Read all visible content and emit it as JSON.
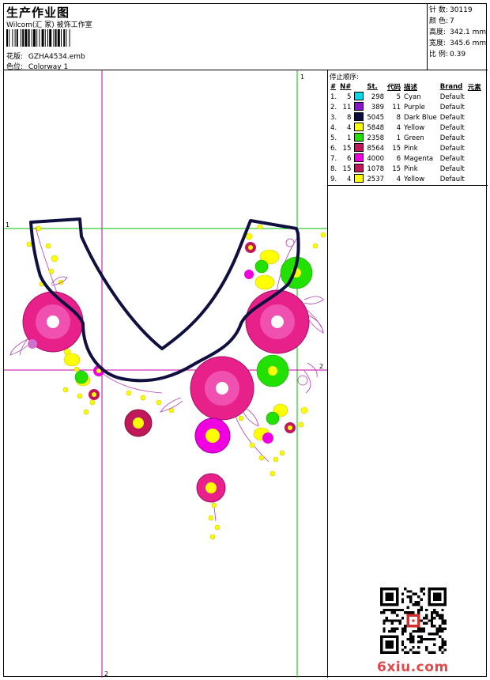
{
  "header": {
    "title": "生产作业图",
    "subtitle": "Wilcom(汇 冢) 被饰工作室",
    "design_label": "花版:",
    "design_value": "GZHA4534.emb",
    "colorway_label": "色位:",
    "colorway_value": "Colorway 1"
  },
  "stats": [
    {
      "label": "针 数:",
      "value": "30119"
    },
    {
      "label": "颜 色:",
      "value": "7"
    },
    {
      "label": "高度:",
      "value": "342.1 mm"
    },
    {
      "label": "宽度:",
      "value": "345.6 mm"
    },
    {
      "label": "比 例:",
      "value": "0.39"
    }
  ],
  "stop_sequence": {
    "title": "停止顺序:",
    "columns": [
      "#",
      "N#",
      "St.",
      "代码",
      "描述",
      "Brand",
      "元素"
    ],
    "rows": [
      {
        "idx": "1.",
        "n": "5",
        "color": "#00d8e8",
        "st": "298",
        "code": "5",
        "desc": "Cyan",
        "brand": "Default"
      },
      {
        "idx": "2.",
        "n": "11",
        "color": "#8a14c8",
        "st": "389",
        "code": "11",
        "desc": "Purple",
        "brand": "Default"
      },
      {
        "idx": "3.",
        "n": "8",
        "color": "#0c0c40",
        "st": "5045",
        "code": "8",
        "desc": "Dark Blue",
        "brand": "Default"
      },
      {
        "idx": "4.",
        "n": "4",
        "color": "#ffff00",
        "st": "5848",
        "code": "4",
        "desc": "Yellow",
        "brand": "Default"
      },
      {
        "idx": "5.",
        "n": "1",
        "color": "#22e000",
        "st": "2358",
        "code": "1",
        "desc": "Green",
        "brand": "Default"
      },
      {
        "idx": "6.",
        "n": "15",
        "color": "#c0185a",
        "st": "8564",
        "code": "15",
        "desc": "Pink",
        "brand": "Default"
      },
      {
        "idx": "7.",
        "n": "6",
        "color": "#f000e0",
        "st": "4000",
        "code": "6",
        "desc": "Magenta",
        "brand": "Default"
      },
      {
        "idx": "8.",
        "n": "15",
        "color": "#c0185a",
        "st": "1078",
        "code": "15",
        "desc": "Pink",
        "brand": "Default"
      },
      {
        "idx": "9.",
        "n": "4",
        "color": "#ffff00",
        "st": "2537",
        "code": "4",
        "desc": "Yellow",
        "brand": "Default"
      }
    ]
  },
  "guides": {
    "v1": "1",
    "v2": "2",
    "h1": "1",
    "h2": "2"
  },
  "watermark": "6xiu.com",
  "colors": {
    "guide_green": "#00c000",
    "guide_magenta": "#c000a0",
    "outline": "#101040",
    "pink": "#e8208a",
    "magenta": "#f000e0",
    "yellow": "#ffff00",
    "green": "#22e000"
  }
}
